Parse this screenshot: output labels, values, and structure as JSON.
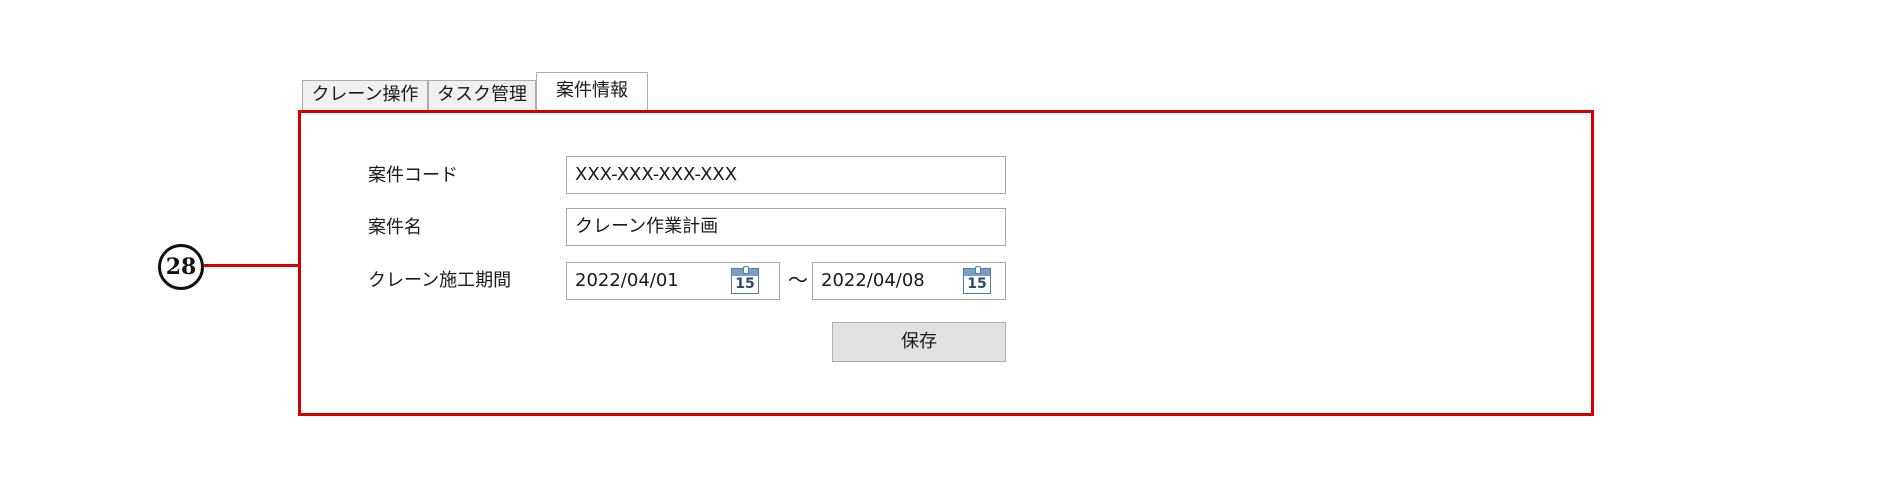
{
  "tabs": [
    {
      "label": "クレーン操作",
      "active": false
    },
    {
      "label": "タスク管理",
      "active": false
    },
    {
      "label": "案件情報",
      "active": true
    }
  ],
  "callout": {
    "number": "28",
    "color": "#d40000"
  },
  "form": {
    "project_code": {
      "label": "案件コード",
      "value": "XXX-XXX-XXX-XXX"
    },
    "project_name": {
      "label": "案件名",
      "value": "クレーン作業計画"
    },
    "period": {
      "label": "クレーン施工期間",
      "start": "2022/04/01",
      "end": "2022/04/08",
      "separator": "〜",
      "calendar_icon_text": "15"
    },
    "save_label": "保存"
  }
}
